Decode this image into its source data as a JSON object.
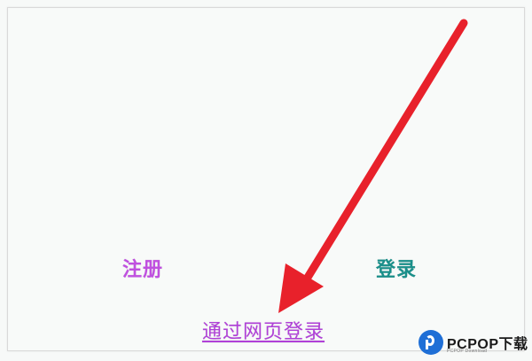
{
  "screen": {
    "background": "#f8faf9"
  },
  "links": {
    "register": {
      "label": "注册",
      "color": "#c050e0"
    },
    "login": {
      "label": "登录",
      "color": "#1a8f8a"
    },
    "web_login": {
      "label": "通过网页登录",
      "color": "#b040d8"
    }
  },
  "annotation": {
    "arrow_color": "#e8212b"
  },
  "watermark": {
    "brand": "PCPOP下载",
    "tagline": "PCPOP Download",
    "icon": "pcpop-logo-icon"
  }
}
